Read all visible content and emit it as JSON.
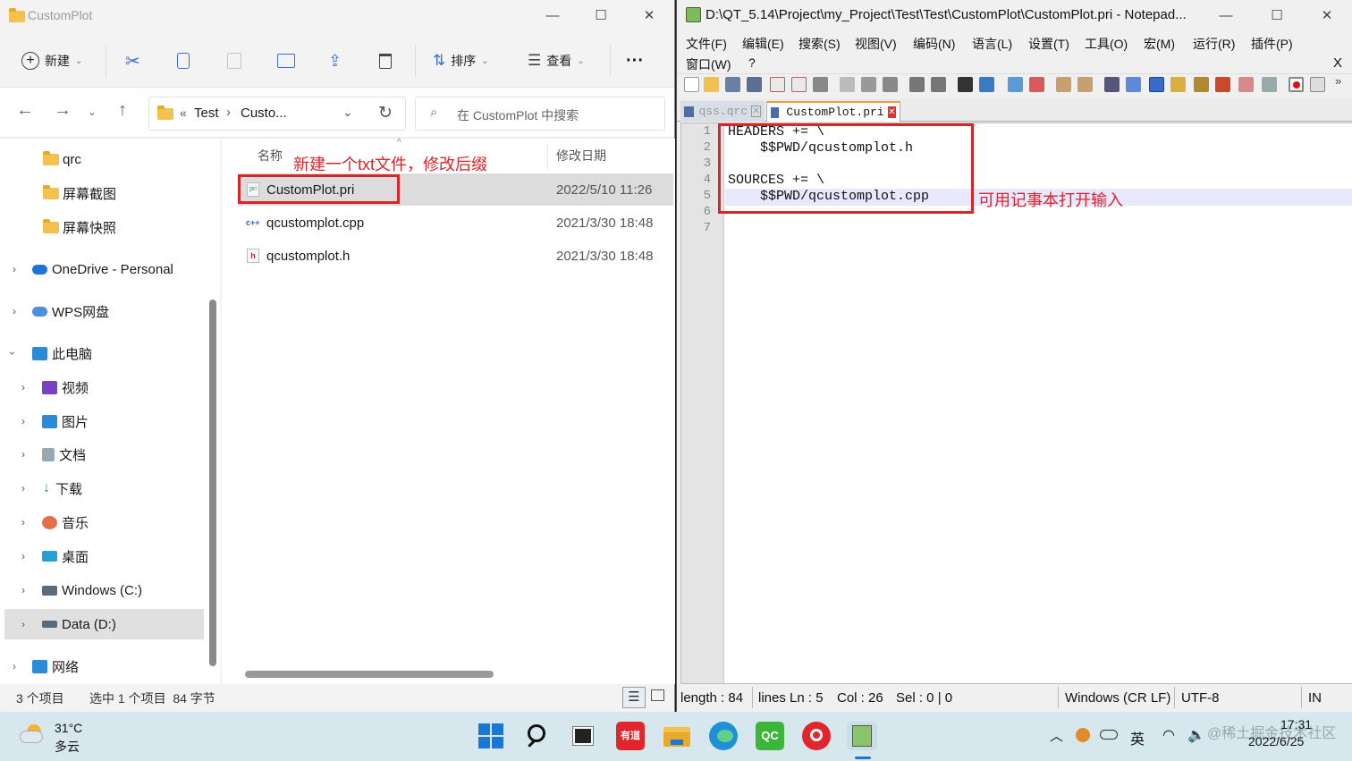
{
  "explorer": {
    "title": "CustomPlot",
    "toolbar": {
      "new_label": "新建",
      "sort_label": "排序",
      "view_label": "查看",
      "more_label": "···"
    },
    "address": {
      "breadcrumb_prefix": "«",
      "crumb1": "Test",
      "sep": "›",
      "crumb2": "Custo..."
    },
    "search_placeholder": "在 CustomPlot 中搜索",
    "sidebar": {
      "items": [
        {
          "label": "qrc"
        },
        {
          "label": "屏幕截图"
        },
        {
          "label": "屏幕快照"
        },
        {
          "label": "OneDrive - Personal"
        },
        {
          "label": "WPS网盘"
        },
        {
          "label": "此电脑"
        },
        {
          "label": "视频"
        },
        {
          "label": "图片"
        },
        {
          "label": "文档"
        },
        {
          "label": "下载"
        },
        {
          "label": "音乐"
        },
        {
          "label": "桌面"
        },
        {
          "label": "Windows (C:)"
        },
        {
          "label": "Data (D:)"
        },
        {
          "label": "网络"
        }
      ]
    },
    "columns": {
      "name": "名称",
      "modified": "修改日期"
    },
    "files": [
      {
        "name": "CustomPlot.pri",
        "date": "2022/5/10 11:26",
        "icon_text": "pri"
      },
      {
        "name": "qcustomplot.cpp",
        "date": "2021/3/30 18:48",
        "icon_text": "c++"
      },
      {
        "name": "qcustomplot.h",
        "date": "2021/3/30 18:48",
        "icon_text": "h"
      }
    ],
    "annotation": "新建一个txt文件，修改后缀",
    "status": {
      "count": "3 个项目",
      "selection": "选中 1 个项目  84 字节"
    }
  },
  "notepad": {
    "title": "D:\\QT_5.14\\Project\\my_Project\\Test\\Test\\CustomPlot\\CustomPlot.pri - Notepad...",
    "menu_row1": [
      "文件(F)",
      "编辑(E)",
      "搜索(S)",
      "视图(V)",
      "编码(N)",
      "语言(L)",
      "设置(T)",
      "工具(O)",
      "宏(M)",
      "运行(R)",
      "插件(P)"
    ],
    "menu_row2": [
      "窗口(W)",
      "?"
    ],
    "close_x": "X",
    "tabs": [
      {
        "label": "qss.qrc"
      },
      {
        "label": "CustomPlot.pri"
      }
    ],
    "lines": [
      {
        "num": "1",
        "text": "HEADERS += \\"
      },
      {
        "num": "2",
        "text": "    $$PWD/qcustomplot.h"
      },
      {
        "num": "3",
        "text": ""
      },
      {
        "num": "4",
        "text": "SOURCES += \\"
      },
      {
        "num": "5",
        "text": "    $$PWD/qcustomplot.cpp"
      },
      {
        "num": "6",
        "text": ""
      },
      {
        "num": "7",
        "text": ""
      }
    ],
    "annotation": "可用记事本打开输入",
    "status": {
      "length": "length : 84",
      "lines": "lines Ln : 5",
      "col": "Col : 26",
      "sel": "Sel : 0 | 0",
      "eol": "Windows (CR LF)",
      "encoding": "UTF-8",
      "ins": "IN"
    }
  },
  "taskbar": {
    "weather_temp": "31°C",
    "weather_desc": "多云",
    "youdao_label": "有道",
    "qt_label": "QC",
    "ime": "英",
    "time": "17:31",
    "date": "2022/6/25",
    "watermark": "@稀土掘金技术社区"
  }
}
